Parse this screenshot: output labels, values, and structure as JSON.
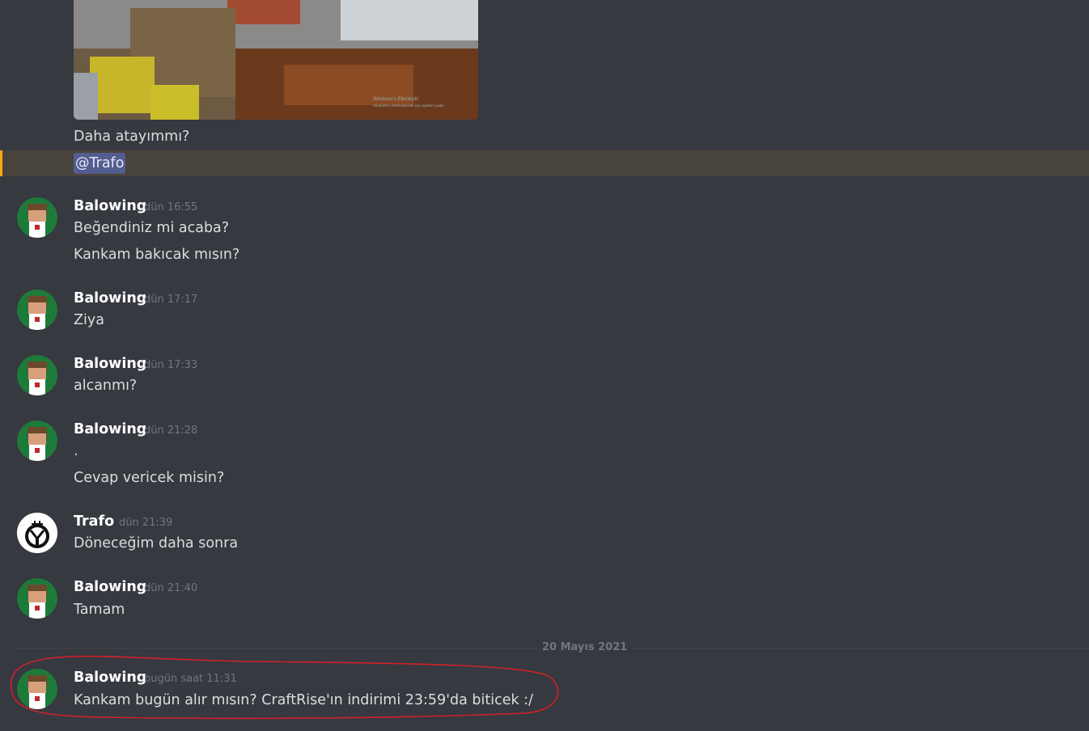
{
  "attachment": {
    "watermark_line1": "Windows'u Etkinleştir",
    "watermark_line2": "Windows'u etkinleştirmek için Ayarlar'a gidin."
  },
  "top_messages": {
    "line1": "Daha atayımmı?",
    "mention": "@Trafo"
  },
  "groups": [
    {
      "author": "Balowing",
      "time": "dün 16:55",
      "lines": [
        "Beğendiniz mi acaba?",
        "Kankam bakıcak mısın?"
      ],
      "avatar": "balowing-avatar"
    },
    {
      "author": "Balowing",
      "time": "dün 17:17",
      "lines": [
        "Ziya"
      ],
      "avatar": "balowing-avatar"
    },
    {
      "author": "Balowing",
      "time": "dün 17:33",
      "lines": [
        "alcanmı?"
      ],
      "avatar": "balowing-avatar"
    },
    {
      "author": "Balowing",
      "time": "dün 21:28",
      "lines": [
        ".",
        "Cevap vericek misin?"
      ],
      "avatar": "balowing-avatar"
    },
    {
      "author": "Trafo",
      "time": "dün 21:39",
      "lines": [
        "Döneceğim daha sonra"
      ],
      "avatar": "trafo-avatar"
    },
    {
      "author": "Balowing",
      "time": "dün 21:40",
      "lines": [
        "Tamam"
      ],
      "avatar": "balowing-avatar"
    },
    {
      "author": "Balowing",
      "time": "bugün saat 11:31",
      "lines": [
        "Kankam bugün alır mısın?  CraftRise'ın indirimi 23:59'da biticek :/"
      ],
      "avatar": "balowing-avatar"
    }
  ],
  "date_divider": "20 Mayıs 2021",
  "colors": {
    "background": "#36393f",
    "mention_highlight": "#49443c",
    "mention_bar": "#faa81a",
    "annotation": "#d0202a"
  }
}
